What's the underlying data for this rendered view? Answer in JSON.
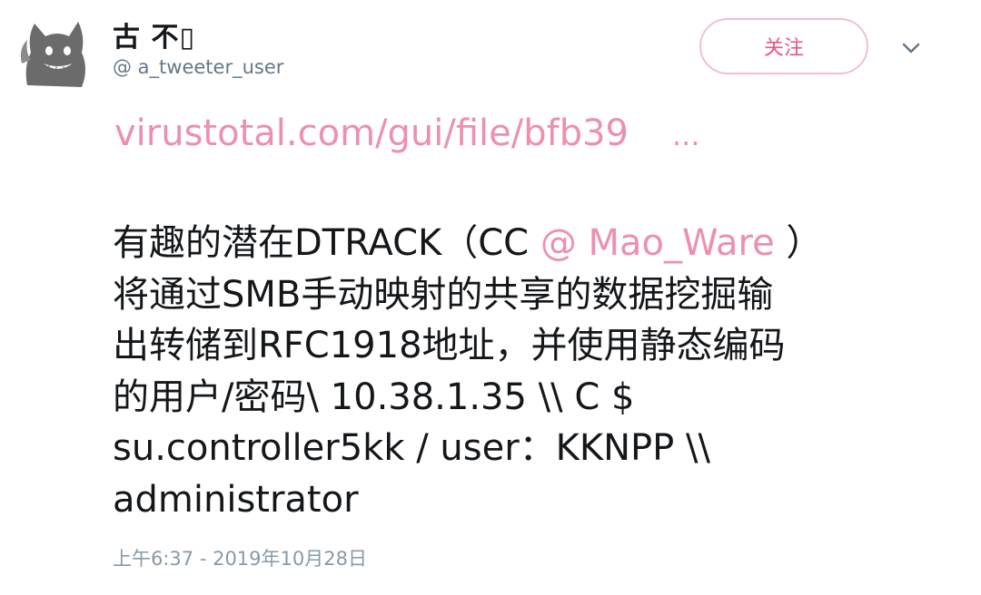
{
  "user": {
    "display_name": "古 不▯",
    "handle": "@ a_tweeter_user",
    "avatar_icon": "cat-avatar-icon"
  },
  "header": {
    "follow_label": "关注",
    "menu_icon": "chevron-down-icon"
  },
  "tweet": {
    "link_text": "virustotal.com/gui/file/bfb39",
    "link_ellipsis": "...",
    "lines": [
      {
        "before": "有趣的潜在DTRACK（CC ",
        "mention": "@ Mao_Ware",
        "after": " ）"
      },
      {
        "before": "将通过SMB手动映射的共享的数据挖掘输",
        "mention": "",
        "after": ""
      },
      {
        "before": "出转储到RFC1918地址，并使用静态编码",
        "mention": "",
        "after": ""
      },
      {
        "before": "的用户/密码\\ 10.38.1.35 \\\\ C $",
        "mention": "",
        "after": ""
      },
      {
        "before": "su.controller5kk / user：KKNPP \\\\",
        "mention": "",
        "after": ""
      },
      {
        "before": "administrator",
        "mention": "",
        "after": ""
      }
    ],
    "timestamp": "上午6:37 - 2019年10月28日"
  },
  "colors": {
    "accent_pink": "#ec8fb0",
    "follow_border": "#f0bfd0",
    "text": "#14171a",
    "muted": "#657786"
  }
}
